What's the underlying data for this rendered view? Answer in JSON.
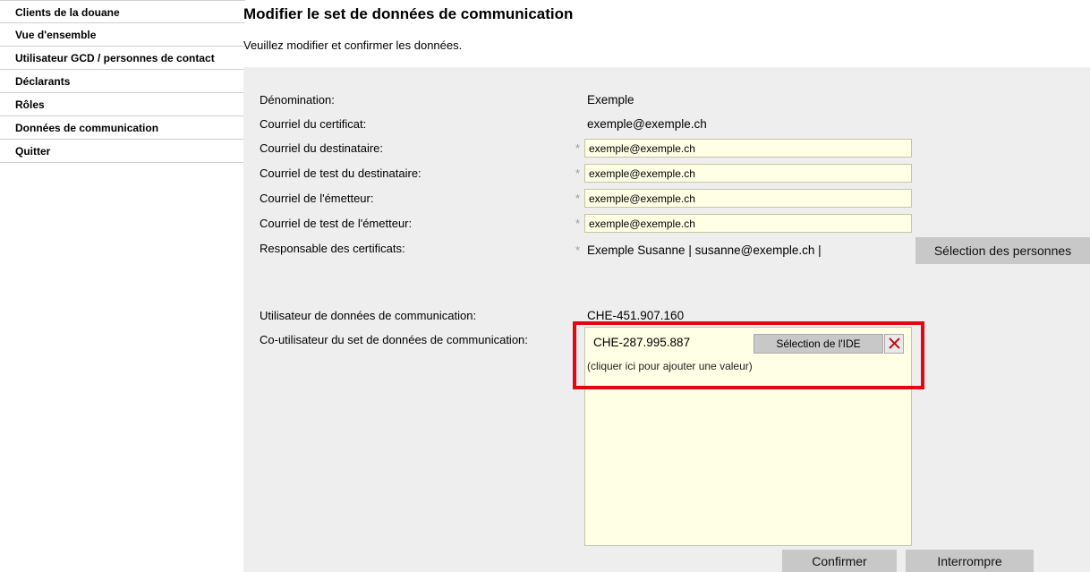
{
  "sidebar": {
    "items": [
      {
        "label": "Clients de la douane"
      },
      {
        "label": "Vue d'ensemble"
      },
      {
        "label": "Utilisateur GCD / personnes de contact"
      },
      {
        "label": "Déclarants"
      },
      {
        "label": "Rôles"
      },
      {
        "label": "Données de communication"
      },
      {
        "label": "Quitter"
      }
    ]
  },
  "header": {
    "title": "Modifier le set de données de communication",
    "subtitle": "Veuillez modifier et confirmer les données."
  },
  "form": {
    "denomination": {
      "label": "Dénomination:",
      "value": "Exemple"
    },
    "cert_email": {
      "label": "Courriel du certificat:",
      "value": "exemple@exemple.ch"
    },
    "recipient_email": {
      "label": "Courriel du destinataire:",
      "value": "exemple@exemple.ch"
    },
    "recipient_test_email": {
      "label": "Courriel de test du destinataire:",
      "value": "exemple@exemple.ch"
    },
    "sender_email": {
      "label": "Courriel de l'émetteur:",
      "value": "exemple@exemple.ch"
    },
    "sender_test_email": {
      "label": "Courriel de test de l'émetteur:",
      "value": "exemple@exemple.ch"
    },
    "cert_manager": {
      "label": "Responsable des certificats:",
      "value": "Exemple Susanne | susanne@exemple.ch |"
    },
    "person_select_label": "Sélection des personnes",
    "comm_user": {
      "label": "Utilisateur de données de communication:",
      "value": "CHE-451.907.160"
    },
    "co_user": {
      "label": "Co-utilisateur du set de données de communication:",
      "value": "CHE-287.995.887",
      "ide_select_label": "Sélection de l'IDE",
      "add_hint": "(cliquer ici pour ajouter une valeur)"
    },
    "required_marker": "*"
  },
  "actions": {
    "confirm_label": "Confirmer",
    "cancel_label": "Interrompre"
  },
  "colors": {
    "input_bg": "#ffffe6",
    "panel_bg": "#eeeeee",
    "highlight": "#e30613",
    "button_bg": "#c8c8c8"
  }
}
